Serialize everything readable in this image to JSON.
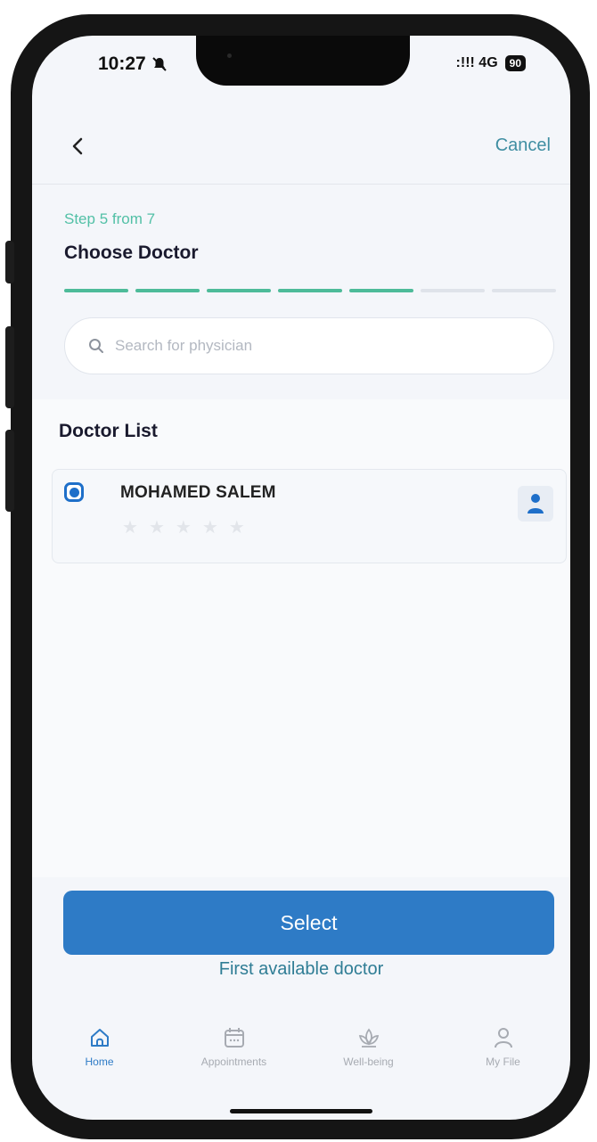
{
  "status_bar": {
    "time": "10:27",
    "signal": ":!!! 4G",
    "battery": "90"
  },
  "nav": {
    "cancel_label": "Cancel"
  },
  "step": {
    "label": "Step 5 from 7",
    "current": 5,
    "total": 7
  },
  "page_title": "Choose Doctor",
  "search": {
    "placeholder": "Search for physician",
    "value": ""
  },
  "doctor_list": {
    "title": "Doctor List",
    "doctors": [
      {
        "name": "MOHAMED SALEM",
        "selected": true,
        "rating": 0,
        "max_rating": 5
      }
    ]
  },
  "actions": {
    "select_label": "Select",
    "first_available_label": "First available doctor"
  },
  "tab_bar": {
    "tabs": [
      {
        "label": "Home",
        "icon": "home-icon",
        "active": true
      },
      {
        "label": "Appointments",
        "icon": "calendar-icon",
        "active": false
      },
      {
        "label": "Well-being",
        "icon": "lotus-icon",
        "active": false
      },
      {
        "label": "My File",
        "icon": "person-icon",
        "active": false
      }
    ]
  },
  "colors": {
    "accent": "#2e7bc6",
    "progress": "#4dbb99",
    "link": "#3f8ea2"
  }
}
